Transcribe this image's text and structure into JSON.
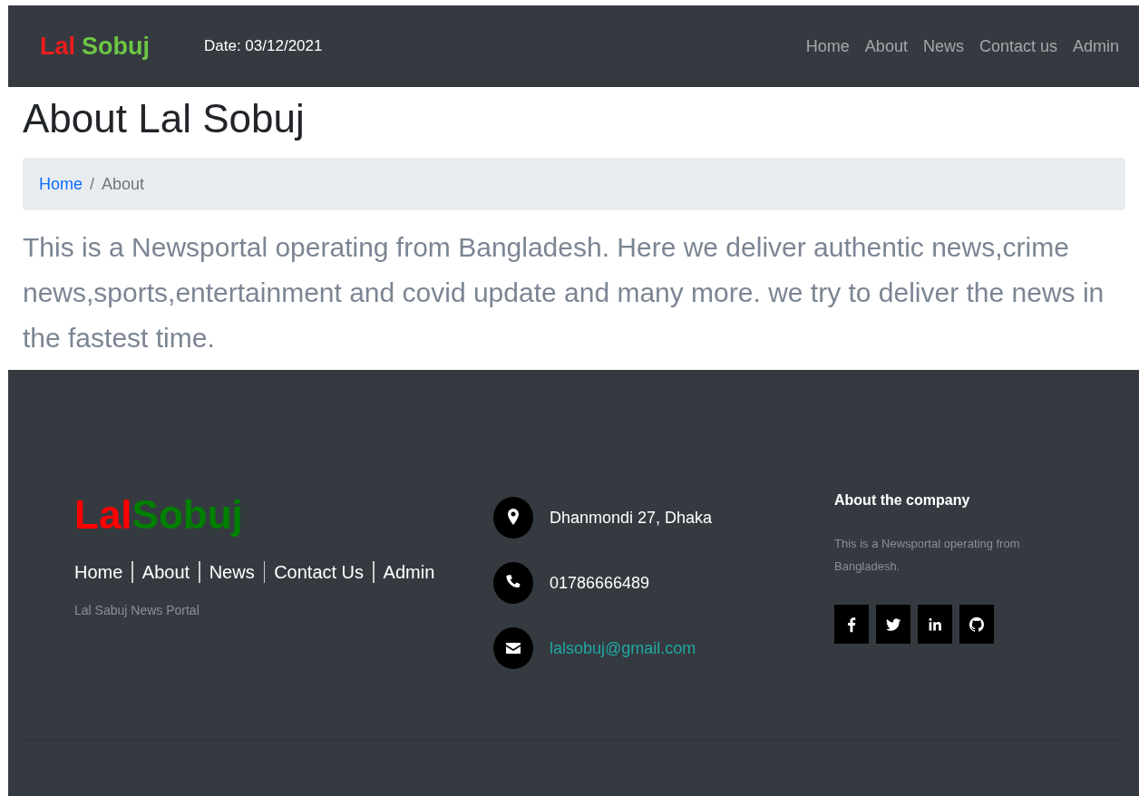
{
  "navbar": {
    "brand": [
      {
        "text": "Lal",
        "color": "#f01c1c"
      },
      {
        "text": "Sobuj",
        "color": "#6cc644"
      }
    ],
    "date": "Date: 03/12/2021",
    "links": [
      "Home",
      "About",
      "News",
      "Contact us",
      "Admin"
    ]
  },
  "page": {
    "title": "About Lal Sobuj",
    "breadcrumb_separator": "/",
    "breadcrumb": [
      {
        "label": "Home",
        "kind": "link"
      },
      {
        "label": "About",
        "kind": "current"
      }
    ],
    "text": "This is a Newsportal operating from Bangladesh. Here we deliver authentic news,crime news,sports,entertainment and covid update and many more. we try to deliver the news in the fastest time."
  },
  "footer": {
    "brand": [
      {
        "text": "Lal",
        "color": "#ff0000"
      },
      {
        "text": "Sobuj",
        "color": "#008000"
      }
    ],
    "links": [
      "Home",
      "About",
      "News",
      "Contact Us",
      "Admin"
    ],
    "tagline": "Lal Sabuj News Portal",
    "contacts": [
      {
        "kind": "location",
        "text": "Dhanmondi 27, Dhaka"
      },
      {
        "kind": "phone",
        "text": "01786666489"
      },
      {
        "kind": "email",
        "text": "lalsobuj@gmail.com"
      }
    ],
    "about_heading": "About the company",
    "about_text": "This is a Newsportal operating from Bangladesh.",
    "social": [
      {
        "kind": "facebook"
      },
      {
        "kind": "twitter"
      },
      {
        "kind": "linkedin"
      },
      {
        "kind": "github"
      }
    ]
  }
}
